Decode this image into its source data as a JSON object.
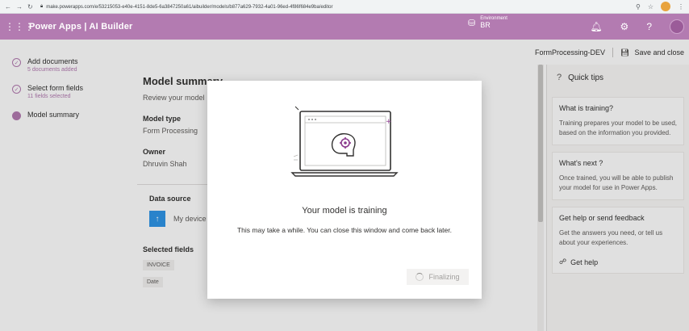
{
  "browser": {
    "url": "make.powerapps.com/e/53215053-e40e-4151-8de5-6a3847250a61/aibuilder/models/b877a629-7932-4a01-96ed-4f86f684e9ba/editor",
    "back_icon": "back-arrow-icon",
    "forward_icon": "forward-arrow-icon",
    "reload_icon": "reload-icon",
    "lock_icon": "lock-icon"
  },
  "appbar": {
    "waffle_icon": "waffle-icon",
    "title": "Power Apps  |  AI Builder",
    "environment_label": "Environment",
    "environment_value": "BR",
    "background": "#b37bb1"
  },
  "steps": [
    {
      "title": "Add documents",
      "sub": "5 documents added",
      "state": "done"
    },
    {
      "title": "Select form fields",
      "sub": "11 fields selected",
      "state": "done"
    },
    {
      "title": "Model summary",
      "sub": "",
      "state": "active"
    }
  ],
  "toolbar": {
    "model_name": "FormProcessing-DEV",
    "save_label": "Save and close"
  },
  "main": {
    "title": "Model summary",
    "review": "Review your model",
    "model_type_label": "Model type",
    "model_type_value": "Form Processing",
    "owner_label": "Owner",
    "owner_value": "Dhruvin Shah",
    "data_source_label": "Data source",
    "data_source_value": "My device",
    "selected_fields_label": "Selected fields",
    "fields": [
      "INVOICE",
      "Date"
    ]
  },
  "tips": {
    "heading": "Quick tips",
    "items": [
      {
        "title": "What is training?",
        "body": "Training prepares your model to be used, based on the information you provided."
      },
      {
        "title": "What's next ?",
        "body": "Once trained, you will be able to publish your model for use in Power Apps."
      },
      {
        "title": "Get help or send feedback",
        "body": "Get the answers you need, or tell us about your experiences.",
        "link": "Get help"
      }
    ]
  },
  "modal": {
    "title": "Your model is training",
    "description": "This may take a while. You can close this window and come back later.",
    "button_label": "Finalizing"
  }
}
